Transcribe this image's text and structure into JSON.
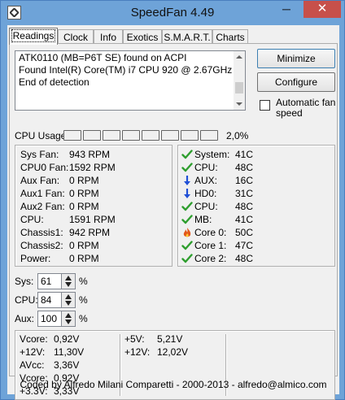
{
  "window": {
    "title": "SpeedFan 4.49",
    "minimize_glyph": "─",
    "close_glyph": "✕"
  },
  "tabs": [
    {
      "label": "Readings",
      "active": true
    },
    {
      "label": "Clock"
    },
    {
      "label": "Info"
    },
    {
      "label": "Exotics"
    },
    {
      "label": "S.M.A.R.T."
    },
    {
      "label": "Charts"
    }
  ],
  "log": {
    "lines": [
      "ATK0110 (MB=P6T SE) found on ACPI",
      "Found Intel(R) Core(TM) i7 CPU 920 @ 2.67GHz",
      "End of detection"
    ]
  },
  "buttons": {
    "minimize": "Minimize",
    "configure": "Configure"
  },
  "auto_fan_speed": {
    "label": "Automatic fan speed",
    "checked": false
  },
  "cpu_usage": {
    "label": "CPU Usage",
    "bar_count": 8,
    "value": "2,0%"
  },
  "fans": [
    {
      "name": "Sys Fan:",
      "value": "943 RPM"
    },
    {
      "name": "CPU0 Fan:",
      "value": "1592 RPM"
    },
    {
      "name": "Aux Fan:",
      "value": "0 RPM"
    },
    {
      "name": "Aux1 Fan:",
      "value": "0 RPM"
    },
    {
      "name": "Aux2 Fan:",
      "value": "0 RPM"
    },
    {
      "name": "CPU:",
      "value": "1591 RPM"
    },
    {
      "name": "Chassis1:",
      "value": "942 RPM"
    },
    {
      "name": "Chassis2:",
      "value": "0 RPM"
    },
    {
      "name": "Power:",
      "value": "0 RPM"
    }
  ],
  "temps": [
    {
      "name": "System:",
      "value": "41C",
      "icon": "check-icon"
    },
    {
      "name": "CPU:",
      "value": "48C",
      "icon": "check-icon"
    },
    {
      "name": "AUX:",
      "value": "16C",
      "icon": "down-arrow-icon"
    },
    {
      "name": "HD0:",
      "value": "31C",
      "icon": "down-arrow-icon"
    },
    {
      "name": "CPU:",
      "value": "48C",
      "icon": "check-icon"
    },
    {
      "name": "MB:",
      "value": "41C",
      "icon": "check-icon"
    },
    {
      "name": "Core 0:",
      "value": "50C",
      "icon": "flame-icon"
    },
    {
      "name": "Core 1:",
      "value": "47C",
      "icon": "check-icon"
    },
    {
      "name": "Core 2:",
      "value": "48C",
      "icon": "check-icon"
    }
  ],
  "speeds": [
    {
      "label": "Sys:",
      "value": "61",
      "unit": "%"
    },
    {
      "label": "CPU:",
      "value": "84",
      "unit": "%"
    },
    {
      "label": "Aux:",
      "value": "100",
      "unit": "%"
    }
  ],
  "voltages": {
    "col1": [
      {
        "name": "Vcore:",
        "value": "0,92V"
      },
      {
        "name": "+12V:",
        "value": "11,30V"
      },
      {
        "name": "AVcc:",
        "value": "3,36V"
      },
      {
        "name": "Vcore:",
        "value": "0,92V"
      },
      {
        "name": "+3.3V:",
        "value": "3,33V"
      }
    ],
    "col2": [
      {
        "name": "+5V:",
        "value": "5,21V"
      },
      {
        "name": "+12V:",
        "value": "12,02V"
      }
    ]
  },
  "footer": "Coded by Alfredo Milani Comparetti - 2000-2013 - alfredo@almico.com",
  "colors": {
    "titlebar": "#6ea3d8",
    "close_button": "#c7504a",
    "check": "#2e9e2e",
    "arrow": "#1f4fd6",
    "flame": "#e2571a"
  }
}
